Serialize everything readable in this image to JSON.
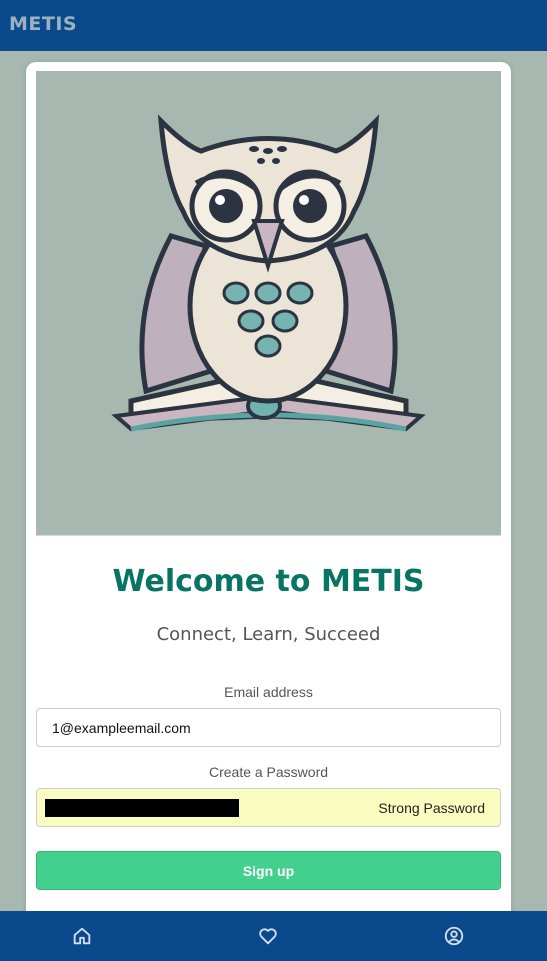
{
  "header": {
    "brand": "METIS"
  },
  "hero": {
    "icon": "owl-reading-book-illustration"
  },
  "welcome": {
    "title": "Welcome to METIS",
    "subtitle": "Connect, Learn, Succeed"
  },
  "form": {
    "email_label": "Email address",
    "email_value": "1@exampleemail.com",
    "password_label": "Create a Password",
    "password_strength": "Strong Password",
    "signup_label": "Sign up"
  },
  "bottom_nav": {
    "items": [
      {
        "icon": "home-icon"
      },
      {
        "icon": "heart-icon"
      },
      {
        "icon": "user-circle-icon"
      }
    ]
  },
  "colors": {
    "primary": "#0a4a8c",
    "accent_title": "#087464",
    "signup": "#43d08f",
    "password_bg": "#fbfcc0",
    "page_bg": "#a7b8b1"
  }
}
